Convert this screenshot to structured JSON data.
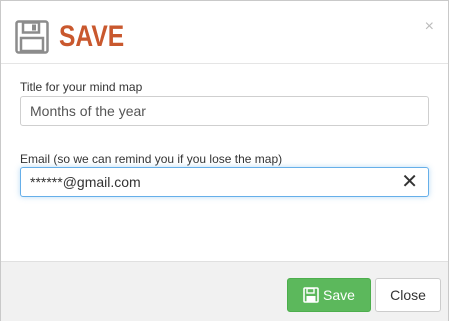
{
  "dialog": {
    "title": "SAVE",
    "close_symbol": "×"
  },
  "form": {
    "title_label": "Title for your mind map",
    "title_value": "Months of the year",
    "email_label": "Email (so we can remind you if you lose the map)",
    "email_value": "******@gmail.com",
    "clear_symbol": "✕"
  },
  "footer": {
    "save_label": "Save",
    "close_label": "Close"
  },
  "icons": {
    "header": "floppy-disk-icon",
    "save_button": "floppy-disk-icon",
    "dialog_close": "close-icon",
    "input_clear": "clear-icon"
  },
  "colors": {
    "title": "#c9582e",
    "save_button": "#5cb85c",
    "focus_border": "#66afe9"
  }
}
